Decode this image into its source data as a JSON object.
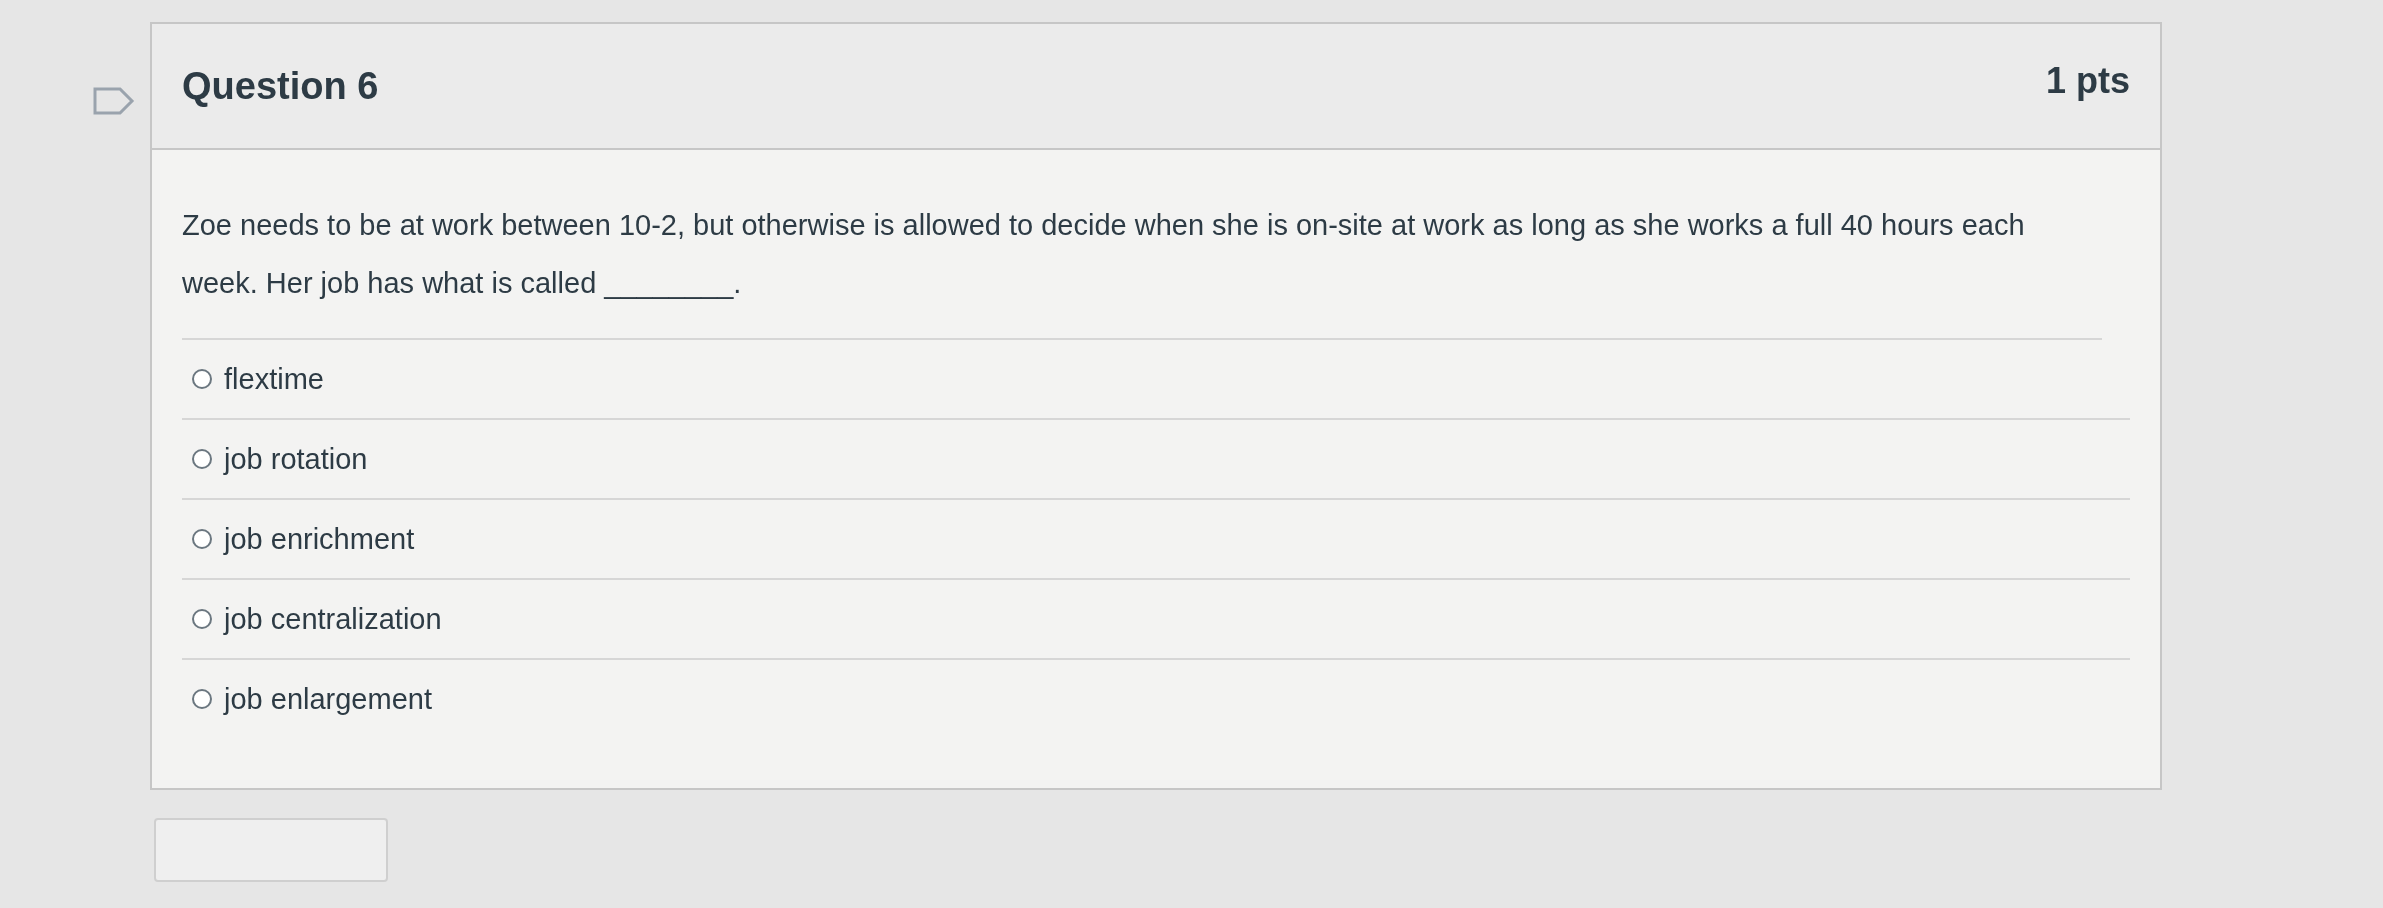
{
  "question": {
    "title": "Question 6",
    "points": "1 pts",
    "text": "Zoe needs to be at work between 10-2, but otherwise is allowed to decide when she is on-site at work as long as she works a full 40 hours each week. Her job has what is called ________.",
    "options": [
      {
        "label": "flextime",
        "selected": false
      },
      {
        "label": "job rotation",
        "selected": false
      },
      {
        "label": "job enrichment",
        "selected": false
      },
      {
        "label": "job centralization",
        "selected": false
      },
      {
        "label": "job enlargement",
        "selected": false
      }
    ]
  }
}
